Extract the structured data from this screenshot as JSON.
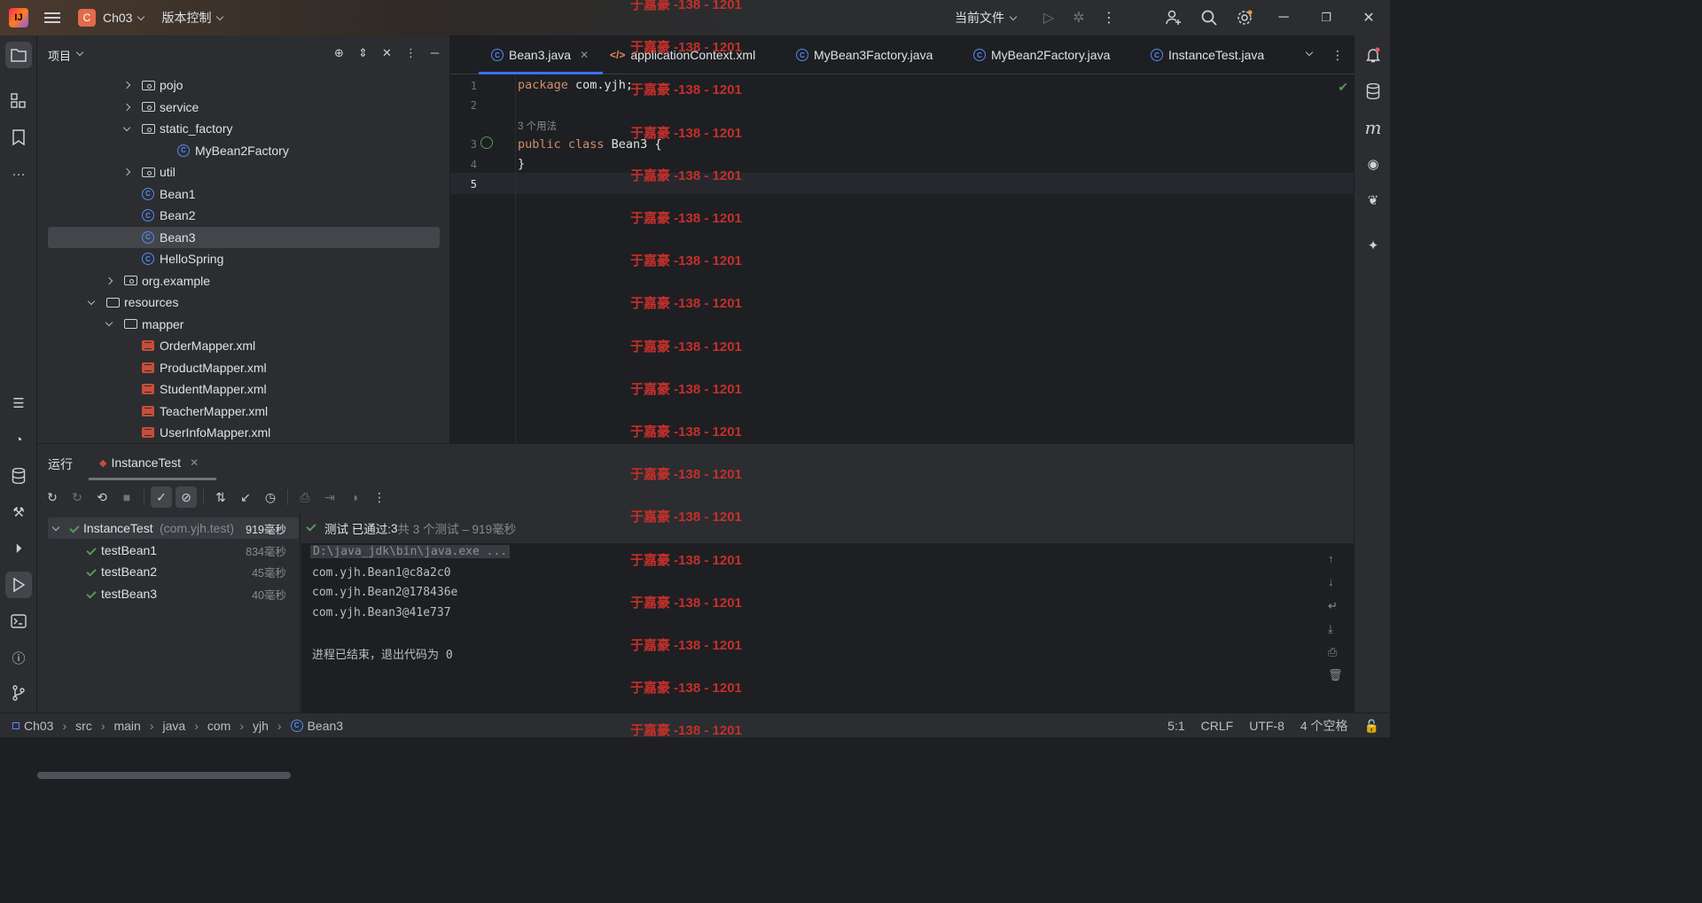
{
  "titlebar": {
    "project_badge": "C",
    "project": "Ch03",
    "vcs": "版本控制",
    "run_config": "当前文件"
  },
  "project_panel": {
    "title": "项目",
    "tree": [
      {
        "label": "pojo",
        "type": "package",
        "state": "collapsed"
      },
      {
        "label": "service",
        "type": "package",
        "state": "collapsed"
      },
      {
        "label": "static_factory",
        "type": "package",
        "state": "expanded"
      },
      {
        "label": "MyBean2Factory",
        "type": "class"
      },
      {
        "label": "util",
        "type": "package",
        "state": "collapsed"
      },
      {
        "label": "Bean1",
        "type": "class"
      },
      {
        "label": "Bean2",
        "type": "class"
      },
      {
        "label": "Bean3",
        "type": "class",
        "selected": true
      },
      {
        "label": "HelloSpring",
        "type": "class"
      },
      {
        "label": "org.example",
        "type": "package",
        "state": "collapsed"
      },
      {
        "label": "resources",
        "type": "folder",
        "state": "expanded"
      },
      {
        "label": "mapper",
        "type": "folder",
        "state": "expanded"
      },
      {
        "label": "OrderMapper.xml",
        "type": "xml"
      },
      {
        "label": "ProductMapper.xml",
        "type": "xml"
      },
      {
        "label": "StudentMapper.xml",
        "type": "xml"
      },
      {
        "label": "TeacherMapper.xml",
        "type": "xml"
      },
      {
        "label": "UserInfoMapper.xml",
        "type": "xml"
      }
    ]
  },
  "editor": {
    "tabs": [
      {
        "label": "Bean3.java",
        "active": true
      },
      {
        "label": "applicationContext.xml"
      },
      {
        "label": "MyBean3Factory.java"
      },
      {
        "label": "MyBean2Factory.java"
      },
      {
        "label": "InstanceTest.java"
      }
    ],
    "line_numbers": [
      "1",
      "2",
      "3",
      "4",
      "5"
    ],
    "code": {
      "l1_kw": "package",
      "l1_rest": " com.yjh;",
      "usages_hint": "3 个用法",
      "l3_kw": "public class",
      "l3_rest": " Bean3 {",
      "l4": "}"
    }
  },
  "run_panel": {
    "title": "运行",
    "tab": "InstanceTest",
    "tests": [
      {
        "name": "InstanceTest",
        "pkg": "(com.yjh.test)",
        "duration": "919毫秒"
      },
      {
        "name": "testBean1",
        "duration": "834毫秒"
      },
      {
        "name": "testBean2",
        "duration": "45毫秒"
      },
      {
        "name": "testBean3",
        "duration": "40毫秒"
      }
    ],
    "status": {
      "prefix": "测试 已通过: ",
      "count": "3",
      "suffix": "共 3 个测试 – 919毫秒"
    },
    "console": [
      "D:\\java_jdk\\bin\\java.exe ...",
      "com.yjh.Bean1@c8a2c0",
      "com.yjh.Bean2@178436e",
      "com.yjh.Bean3@41e737",
      "",
      "进程已结束，退出代码为 0"
    ]
  },
  "statusbar": {
    "breadcrumb": [
      "Ch03",
      "src",
      "main",
      "java",
      "com",
      "yjh",
      "Bean3"
    ],
    "position": "5:1",
    "line_sep": "CRLF",
    "encoding": "UTF-8",
    "indent": "4 个空格"
  },
  "watermark": "于嘉豪 -138 - 1201",
  "colors": {
    "accent": "#3574f0",
    "watermark": "#c4302b",
    "pass": "#57965c"
  }
}
